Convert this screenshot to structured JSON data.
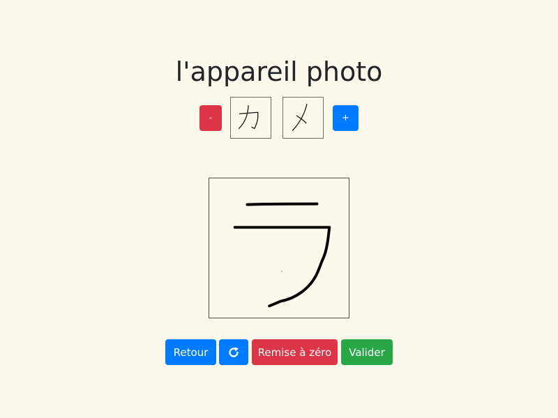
{
  "word": {
    "title": "l'appareil photo"
  },
  "kana_selector": {
    "minus_label": "-",
    "plus_label": "+",
    "kana": [
      {
        "char": "カ"
      },
      {
        "char": "メ"
      }
    ]
  },
  "drawing": {
    "current_kana_drawn": "ラ"
  },
  "actions": {
    "back_label": "Retour",
    "redo_icon": "redo-icon",
    "reset_label": "Remise à zéro",
    "validate_label": "Valider"
  },
  "colors": {
    "background": "#fdf8ec",
    "danger": "#dc3545",
    "primary": "#007bff",
    "success": "#28a745"
  }
}
